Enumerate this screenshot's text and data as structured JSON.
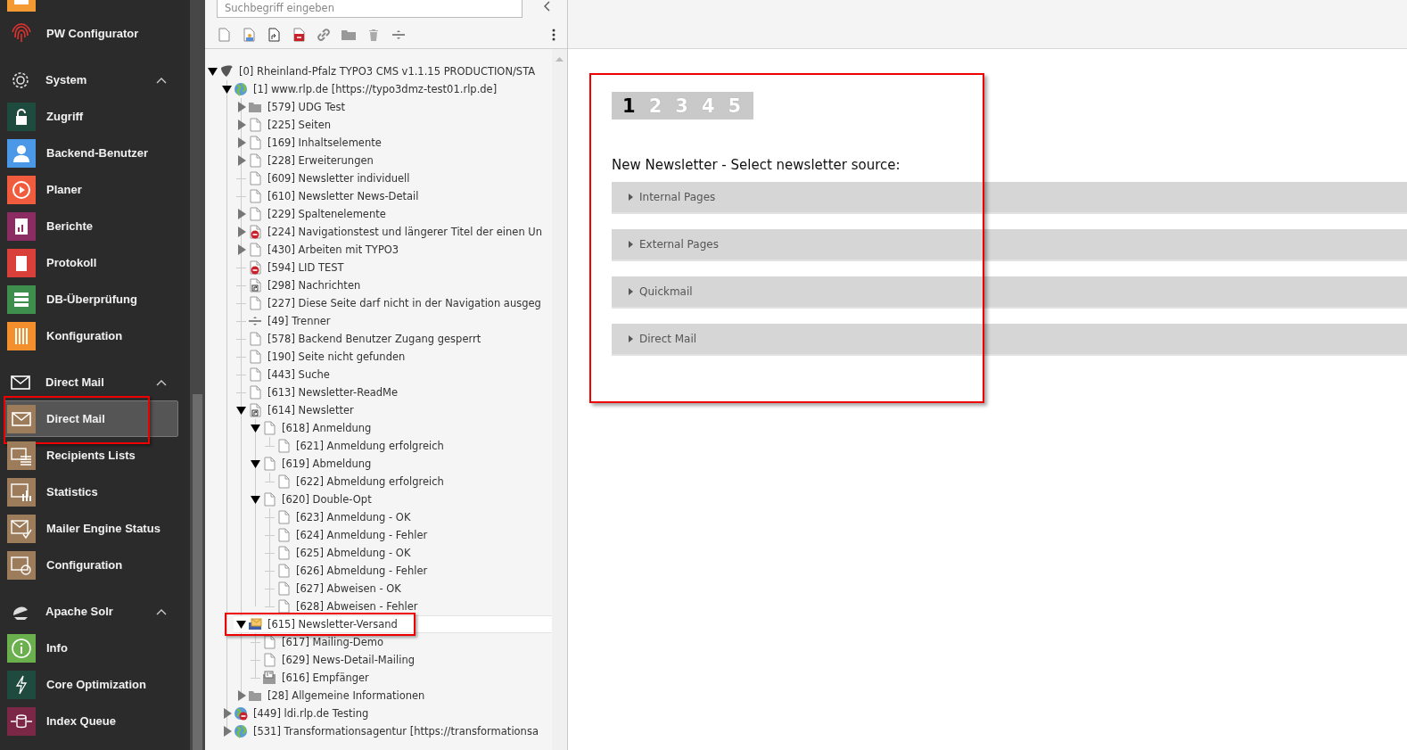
{
  "sidebar": {
    "items": [
      {
        "kind": "item",
        "label": "PW Configurator",
        "color": "#e2322e",
        "selected": false,
        "annotated": false
      },
      {
        "kind": "header",
        "label": "System",
        "expanded": true
      },
      {
        "kind": "item",
        "label": "Zugriff",
        "color": "#1f4b3e",
        "selected": false,
        "annotated": false
      },
      {
        "kind": "item",
        "label": "Backend-Benutzer",
        "color": "#4b97e8",
        "selected": false,
        "annotated": false
      },
      {
        "kind": "item",
        "label": "Planer",
        "color": "#f25c3e",
        "selected": false,
        "annotated": false
      },
      {
        "kind": "item",
        "label": "Berichte",
        "color": "#8b2c62",
        "selected": false,
        "annotated": false
      },
      {
        "kind": "item",
        "label": "Protokoll",
        "color": "#d9403a",
        "selected": false,
        "annotated": false
      },
      {
        "kind": "item",
        "label": "DB-Überprüfung",
        "color": "#3e8e4e",
        "selected": false,
        "annotated": false
      },
      {
        "kind": "item",
        "label": "Konfiguration",
        "color": "#f3902d",
        "selected": false,
        "annotated": false
      },
      {
        "kind": "header",
        "label": "Direct Mail",
        "expanded": true
      },
      {
        "kind": "item",
        "label": "Direct Mail",
        "color": "#9c7c5a",
        "selected": true,
        "annotated": true
      },
      {
        "kind": "item",
        "label": "Recipients Lists",
        "color": "#9c7c5a",
        "selected": false,
        "annotated": false
      },
      {
        "kind": "item",
        "label": "Statistics",
        "color": "#9c7c5a",
        "selected": false,
        "annotated": false
      },
      {
        "kind": "item",
        "label": "Mailer Engine Status",
        "color": "#9c7c5a",
        "selected": false,
        "annotated": false
      },
      {
        "kind": "item",
        "label": "Configuration",
        "color": "#9c7c5a",
        "selected": false,
        "annotated": false
      },
      {
        "kind": "header",
        "label": "Apache Solr",
        "expanded": true
      },
      {
        "kind": "item",
        "label": "Info",
        "color": "#6ab04c",
        "selected": false,
        "annotated": false
      },
      {
        "kind": "item",
        "label": "Core Optimization",
        "color": "#1f4b3e",
        "selected": false,
        "annotated": false
      },
      {
        "kind": "item",
        "label": "Index Queue",
        "color": "#7a2845",
        "selected": false,
        "annotated": false
      }
    ]
  },
  "page_tree": {
    "search": {
      "placeholder": "Suchbegriff eingeben"
    },
    "nodes": [
      {
        "kind": "root",
        "label": "[0] Rheinland-Pfalz TYPO3 CMS v1.1.15 PRODUCTION/STA",
        "expanded": true,
        "selected": false,
        "annotated": false,
        "children": [
          {
            "kind": "globe",
            "label": "[1] www.rlp.de [https://typo3dmz-test01.rlp.de]",
            "expanded": true,
            "selected": false,
            "annotated": false,
            "children": [
              {
                "kind": "folder",
                "label": "[579] UDG Test",
                "expanded": false,
                "selected": false,
                "annotated": false
              },
              {
                "kind": "page",
                "label": "[225] Seiten",
                "expanded": false,
                "selected": false,
                "annotated": false
              },
              {
                "kind": "page",
                "label": "[169] Inhaltselemente",
                "expanded": false,
                "selected": false,
                "annotated": false
              },
              {
                "kind": "page",
                "label": "[228] Erweiterungen",
                "expanded": false,
                "selected": false,
                "annotated": false
              },
              {
                "kind": "page",
                "label": "[609] Newsletter individuell",
                "selected": false,
                "annotated": false
              },
              {
                "kind": "page",
                "label": "[610] Newsletter News-Detail",
                "selected": false,
                "annotated": false
              },
              {
                "kind": "page",
                "label": "[229] Spaltenelemente",
                "expanded": false,
                "selected": false,
                "annotated": false
              },
              {
                "kind": "page-disabled",
                "label": "[224] Navigationstest und längerer Titel der einen Un",
                "expanded": false,
                "selected": false,
                "annotated": false
              },
              {
                "kind": "page",
                "label": "[430] Arbeiten mit TYPO3",
                "expanded": false,
                "selected": false,
                "annotated": false
              },
              {
                "kind": "page-disabled",
                "label": "[594] LID TEST",
                "selected": false,
                "annotated": false
              },
              {
                "kind": "shortcut",
                "label": "[298] Nachrichten",
                "selected": false,
                "annotated": false
              },
              {
                "kind": "page",
                "label": "[227] Diese Seite darf nicht in der Navigation ausgeg",
                "selected": false,
                "annotated": false
              },
              {
                "kind": "separator",
                "label": "[49] Trenner",
                "selected": false,
                "annotated": false
              },
              {
                "kind": "page",
                "label": "[578] Backend Benutzer Zugang gesperrt",
                "selected": false,
                "annotated": false
              },
              {
                "kind": "page",
                "label": "[190] Seite nicht gefunden",
                "selected": false,
                "annotated": false
              },
              {
                "kind": "page",
                "label": "[443] Suche",
                "selected": false,
                "annotated": false
              },
              {
                "kind": "page",
                "label": "[613] Newsletter-ReadMe",
                "selected": false,
                "annotated": false
              },
              {
                "kind": "shortcut",
                "label": "[614] Newsletter",
                "expanded": true,
                "selected": false,
                "annotated": false,
                "children": [
                  {
                    "kind": "page",
                    "label": "[618] Anmeldung",
                    "expanded": true,
                    "selected": false,
                    "annotated": false,
                    "children": [
                      {
                        "kind": "page",
                        "label": "[621] Anmeldung erfolgreich",
                        "selected": false,
                        "annotated": false
                      }
                    ]
                  },
                  {
                    "kind": "page",
                    "label": "[619] Abmeldung",
                    "expanded": true,
                    "selected": false,
                    "annotated": false,
                    "children": [
                      {
                        "kind": "page",
                        "label": "[622] Abmeldung erfolgreich",
                        "selected": false,
                        "annotated": false
                      }
                    ]
                  },
                  {
                    "kind": "page",
                    "label": "[620] Double-Opt",
                    "expanded": true,
                    "selected": false,
                    "annotated": false,
                    "children": [
                      {
                        "kind": "page",
                        "label": "[623] Anmeldung - OK",
                        "selected": false,
                        "annotated": false
                      },
                      {
                        "kind": "page",
                        "label": "[624] Anmeldung - Fehler",
                        "selected": false,
                        "annotated": false
                      },
                      {
                        "kind": "page",
                        "label": "[625] Abmeldung - OK",
                        "selected": false,
                        "annotated": false
                      },
                      {
                        "kind": "page",
                        "label": "[626] Abmeldung - Fehler",
                        "selected": false,
                        "annotated": false
                      },
                      {
                        "kind": "page",
                        "label": "[627] Abweisen - OK",
                        "selected": false,
                        "annotated": false
                      },
                      {
                        "kind": "page",
                        "label": "[628] Abweisen - Fehler",
                        "selected": false,
                        "annotated": false
                      }
                    ]
                  }
                ]
              },
              {
                "kind": "mailfolder",
                "label": "[615] Newsletter-Versand",
                "expanded": true,
                "selected": true,
                "annotated": true,
                "children": [
                  {
                    "kind": "page",
                    "label": "[617] Mailing-Demo",
                    "selected": false,
                    "annotated": false
                  },
                  {
                    "kind": "page",
                    "label": "[629] News-Detail-Mailing",
                    "selected": false,
                    "annotated": false
                  },
                  {
                    "kind": "sysfolder",
                    "label": "[616] Empfänger",
                    "selected": false,
                    "annotated": false
                  }
                ]
              },
              {
                "kind": "folder",
                "label": "[28] Allgemeine Informationen",
                "expanded": false,
                "selected": false,
                "annotated": false
              }
            ]
          },
          {
            "kind": "globe-disabled",
            "label": "[449] ldi.rlp.de Testing",
            "expanded": false,
            "selected": false,
            "annotated": false
          },
          {
            "kind": "globe",
            "label": "[531] Transformationsagentur [https://transformationsa",
            "expanded": false,
            "selected": false,
            "annotated": false
          }
        ]
      }
    ]
  },
  "wizard": {
    "annotated": true,
    "steps": [
      {
        "label": "1",
        "selected": true
      },
      {
        "label": "2",
        "selected": false
      },
      {
        "label": "3",
        "selected": false
      },
      {
        "label": "4",
        "selected": false
      },
      {
        "label": "5",
        "selected": false
      }
    ],
    "heading": "New Newsletter - Select newsletter source:",
    "sections": [
      {
        "label": "Internal Pages",
        "expanded": false
      },
      {
        "label": "External Pages",
        "expanded": false
      },
      {
        "label": "Quickmail",
        "expanded": false
      },
      {
        "label": "Direct Mail",
        "expanded": false
      }
    ]
  }
}
